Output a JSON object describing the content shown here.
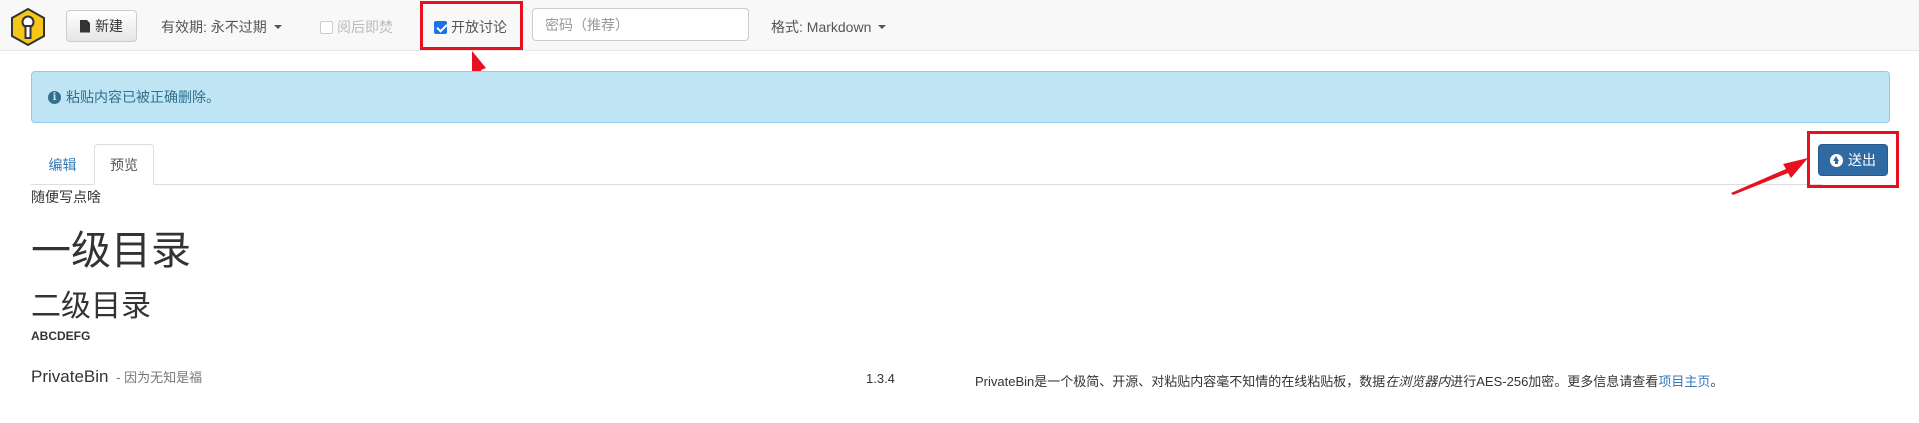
{
  "navbar": {
    "new_button": "新建",
    "expiration": "有效期: 永不过期",
    "burn_after_reading": "阅后即焚",
    "open_discussion": "开放讨论",
    "password_placeholder": "密码（推荐）",
    "format": "格式: Markdown"
  },
  "alert": {
    "message": "粘贴内容已被正确删除。"
  },
  "tabs": {
    "edit": "编辑",
    "preview": "预览"
  },
  "send_button": "送出",
  "preview": {
    "paragraph": "随便写点啥",
    "h1": "一级目录",
    "h2": "二级目录",
    "h3": "ABCDEFG"
  },
  "footer": {
    "name": "PrivateBin",
    "slogan": "- 因为无知是福",
    "version": "1.3.4",
    "info_before": "PrivateBin是一个极简、开源、对粘贴内容毫不知情的在线粘贴板，数据",
    "info_em": "在浏览器内",
    "info_after": "进行AES-256加密。更多信息请查看",
    "info_link": "项目主页",
    "info_end": "。"
  },
  "colors": {
    "highlight": "#e8101f",
    "alert_bg": "#bfe4f3",
    "send_button": "#2f6aa3",
    "link": "#337ab7"
  }
}
